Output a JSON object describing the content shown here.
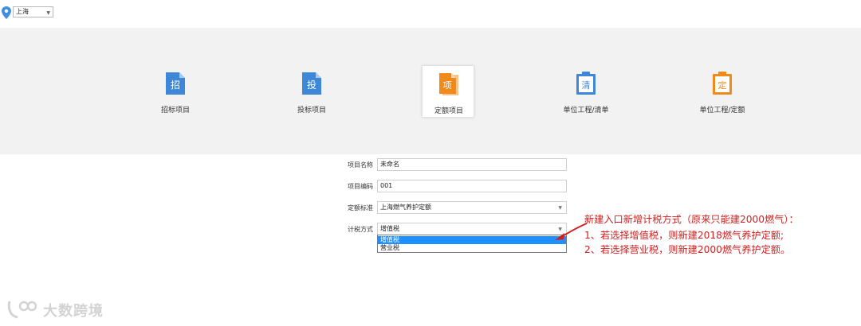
{
  "region": {
    "value": "上海"
  },
  "tiles": [
    {
      "label": "招标项目",
      "glyph": "招",
      "color": "#3e87d8"
    },
    {
      "label": "投标项目",
      "glyph": "投",
      "color": "#3e87d8"
    },
    {
      "label": "定额项目",
      "glyph": "项",
      "color": "#f08a1c"
    },
    {
      "label": "单位工程/清单",
      "glyph": "清",
      "color": "#3e87d8"
    },
    {
      "label": "单位工程/定额",
      "glyph": "定",
      "color": "#f08a1c"
    }
  ],
  "form": {
    "project_name": {
      "label": "项目名称",
      "value": "未命名"
    },
    "project_code": {
      "label": "项目编码",
      "value": "001"
    },
    "quota_standard": {
      "label": "定额标准",
      "value": "上海燃气养护定额"
    },
    "tax_method": {
      "label": "计税方式",
      "value": "增值税",
      "options": [
        "增值税",
        "营业税"
      ]
    }
  },
  "annotation": {
    "line1": "新建入口新增计税方式（原来只能建2000燃气）：",
    "line2": "1、若选择增值税，则新建2018燃气养护定额;",
    "line3": "2、若选择营业税，则新建2000燃气养护定额。"
  },
  "watermark": {
    "text": "大数跨境"
  }
}
